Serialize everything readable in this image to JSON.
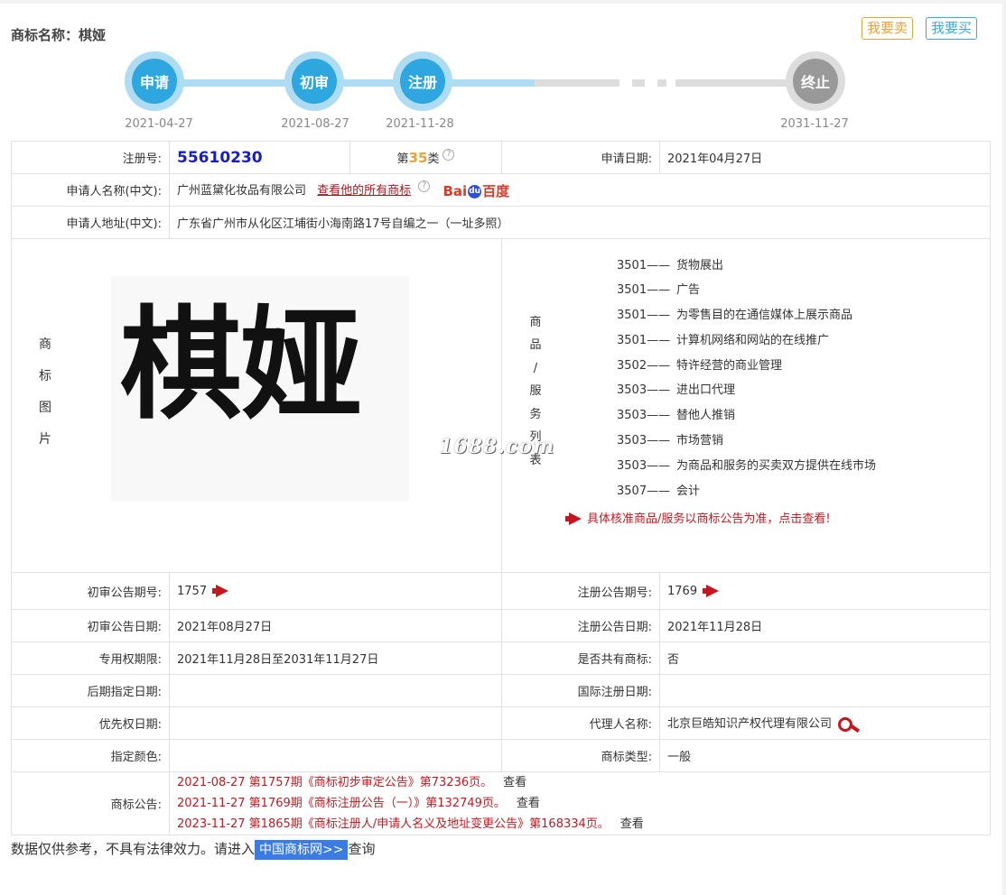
{
  "header": {
    "title_label": "商标名称：",
    "title_value": "棋娅",
    "sell_label": "我要卖",
    "buy_label": "我要买"
  },
  "timeline": {
    "steps": [
      {
        "label": "申请",
        "date": "2021-04-27",
        "state": "done"
      },
      {
        "label": "初审",
        "date": "2021-08-27",
        "state": "done"
      },
      {
        "label": "注册",
        "date": "2021-11-28",
        "state": "done"
      },
      {
        "label": "终止",
        "date": "2031-11-27",
        "state": "future"
      }
    ]
  },
  "info": {
    "reg_no_label": "注册号:",
    "reg_no": "55610230",
    "class_prefix": "第",
    "class_num": "35",
    "class_suffix": "类",
    "apply_date_label": "申请日期:",
    "apply_date": "2021年04月27日",
    "applicant_label": "申请人名称(中文):",
    "applicant": "广州蓝黛化妆品有限公司",
    "applicant_link": "查看他的所有商标",
    "baidu_left": "Bai",
    "baidu_paw": "du",
    "baidu_right": "百度",
    "address_label": "申请人地址(中文):",
    "address": "广东省广州市从化区江埔街小海南路17号自编之一（一址多照）",
    "image_label": [
      "商",
      "标",
      "图",
      "片"
    ],
    "mark_text": "棋娅",
    "watermark": "1688.com",
    "goods_label": [
      "商",
      "品",
      "/",
      "服",
      "务",
      "列",
      "表"
    ],
    "goods": [
      {
        "code": "3501——",
        "name": "货物展出"
      },
      {
        "code": "3501——",
        "name": "广告"
      },
      {
        "code": "3501——",
        "name": "为零售目的在通信媒体上展示商品"
      },
      {
        "code": "3501——",
        "name": "计算机网络和网站的在线推广"
      },
      {
        "code": "3502——",
        "name": "特许经营的商业管理"
      },
      {
        "code": "3503——",
        "name": "进出口代理"
      },
      {
        "code": "3503——",
        "name": "替他人推销"
      },
      {
        "code": "3503——",
        "name": "市场营销"
      },
      {
        "code": "3503——",
        "name": "为商品和服务的买卖双方提供在线市场"
      },
      {
        "code": "3507——",
        "name": "会计"
      }
    ],
    "goods_note": "具体核准商品/服务以商标公告为准，点击查看!",
    "prelim_no_label": "初审公告期号:",
    "prelim_no": "1757",
    "reg_pub_no_label": "注册公告期号:",
    "reg_pub_no": "1769",
    "prelim_date_label": "初审公告日期:",
    "prelim_date": "2021年08月27日",
    "reg_pub_date_label": "注册公告日期:",
    "reg_pub_date": "2021年11月28日",
    "exclusive_label": "专用权期限:",
    "exclusive": "2021年11月28日至2031年11月27日",
    "shared_label": "是否共有商标:",
    "shared": "否",
    "later_label": "后期指定日期:",
    "later": "",
    "intl_label": "国际注册日期:",
    "intl": "",
    "priority_label": "优先权日期:",
    "priority": "",
    "agent_label": "代理人名称:",
    "agent": "北京巨皓知识产权代理有限公司",
    "color_label": "指定颜色:",
    "color": "",
    "type_label": "商标类型:",
    "type": "一般",
    "notice_label": "商标公告:",
    "notices": [
      {
        "text": "2021-08-27 第1757期《商标初步审定公告》第73236页。",
        "view": "查看"
      },
      {
        "text": "2021-11-27 第1769期《商标注册公告（一）》第132749页。",
        "view": "查看"
      },
      {
        "text": "2023-11-27 第1865期《商标注册人/申请人名义及地址变更公告》第168334页。",
        "view": "查看"
      }
    ]
  },
  "footer": {
    "text_before": "数据仅供参考，不具有法律效力。请进入",
    "link": "中国商标网>>",
    "text_after": "查询"
  },
  "colors": {
    "accent_blue": "#2ea7e0",
    "red": "#c5171f",
    "orange": "#e8a23b"
  }
}
